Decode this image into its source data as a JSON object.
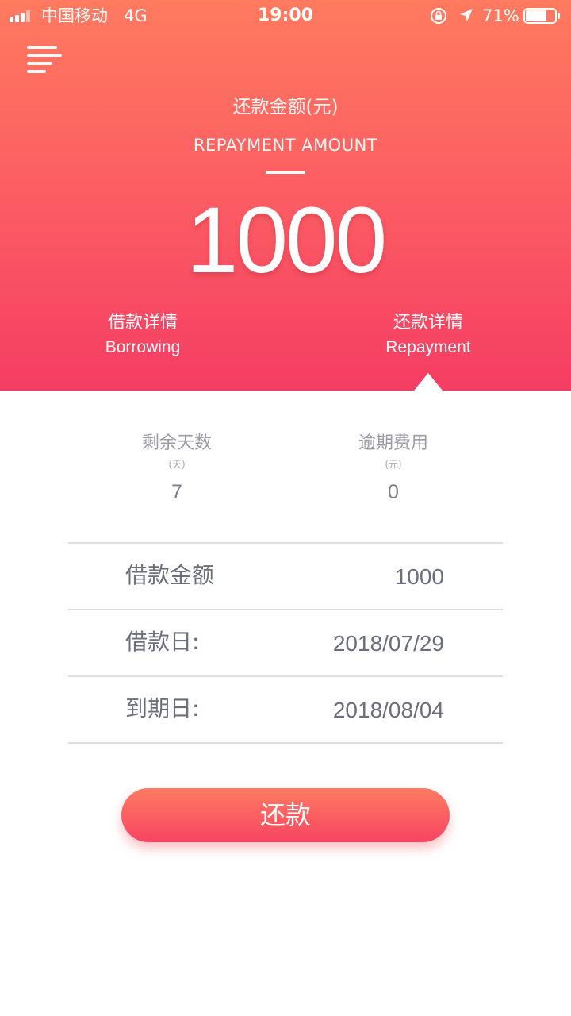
{
  "status_bar": {
    "carrier": "中国移动",
    "network": "4G",
    "time": "19:00",
    "battery_percent": "71%",
    "battery_level": 0.71,
    "icons": [
      "signal-icon",
      "orientation-lock-icon",
      "location-arrow-icon",
      "battery-icon"
    ]
  },
  "header": {
    "menu_icon": "menu-icon",
    "amount_label_cn": "还款金额(元)",
    "amount_label_en": "REPAYMENT AMOUNT",
    "amount_value": "1000",
    "tabs": [
      {
        "cn": "借款详情",
        "en": "Borrowing",
        "active": false
      },
      {
        "cn": "还款详情",
        "en": "Repayment",
        "active": true
      }
    ],
    "colors": {
      "gradient_top": "#ff7a5f",
      "gradient_bottom": "#f53d63"
    }
  },
  "stats": {
    "remaining_days": {
      "label": "剩余天数",
      "unit": "(天)",
      "value": "7"
    },
    "overdue_fee": {
      "label": "逾期费用",
      "unit": "(元)",
      "value": "0"
    }
  },
  "details": [
    {
      "label": "借款金额",
      "value": "1000"
    },
    {
      "label": "借款日:",
      "value": "2018/07/29"
    },
    {
      "label": "到期日:",
      "value": "2018/08/04"
    }
  ],
  "repay_button": {
    "label": "还款",
    "color": "#f74462"
  }
}
